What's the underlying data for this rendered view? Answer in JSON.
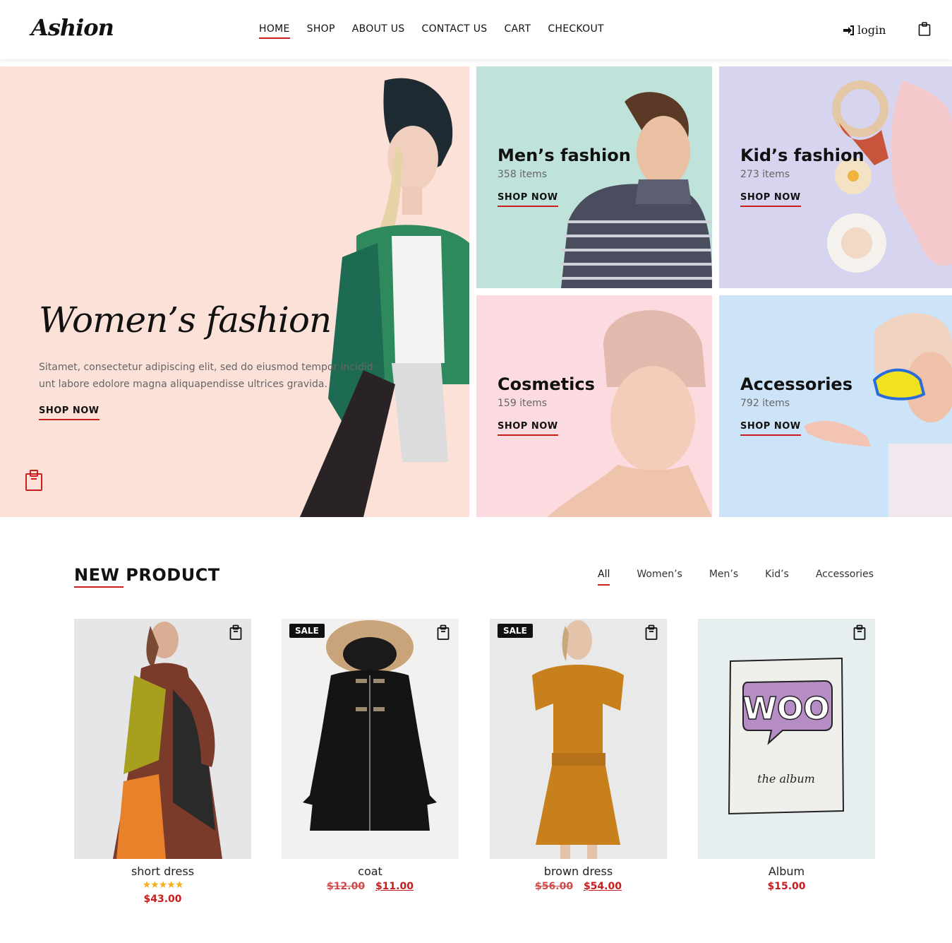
{
  "header": {
    "logo": "Ashion",
    "nav": [
      "HOME",
      "SHOP",
      "ABOUT US",
      "CONTACT US",
      "CART",
      "CHECKOUT"
    ],
    "login": "login"
  },
  "hero": {
    "title": "Women’s fashion",
    "text": "Sitamet, consectetur adipiscing elit, sed do eiusmod tempor incidid-unt labore edolore magna aliquapendisse ultrices gravida.",
    "shop": "SHOP NOW"
  },
  "tiles": [
    {
      "title": "Men’s fashion",
      "count": "358 items",
      "shop": "SHOP NOW",
      "bg": "#bfe3da"
    },
    {
      "title": "Kid’s fashion",
      "count": "273 items",
      "shop": "SHOP NOW",
      "bg": "#d7d4ef"
    },
    {
      "title": "Cosmetics",
      "count": "159 items",
      "shop": "SHOP NOW",
      "bg": "#fbdbe0"
    },
    {
      "title": "Accessories",
      "count": "792 items",
      "shop": "SHOP NOW",
      "bg": "#cde3f7"
    }
  ],
  "new_product": {
    "title": "NEW PRODUCT",
    "filters": [
      "All",
      "Women’s",
      "Men’s",
      "Kid’s",
      "Accessories"
    ]
  },
  "products": [
    {
      "name": "short dress",
      "price": "$43.00",
      "stars": "★★★★★",
      "sale": ""
    },
    {
      "name": "coat",
      "old_price": "$12.00",
      "price": "$11.00",
      "sale": "SALE"
    },
    {
      "name": "brown dress",
      "old_price": "$56.00",
      "price": "$54.00",
      "sale": "SALE"
    },
    {
      "name": "Album",
      "price": "$15.00",
      "sale": "",
      "art_text": "WOO",
      "art_sub": "the album"
    }
  ],
  "colors": {
    "accent": "#c91e1e",
    "hero_bg": "#fbe1d8"
  }
}
